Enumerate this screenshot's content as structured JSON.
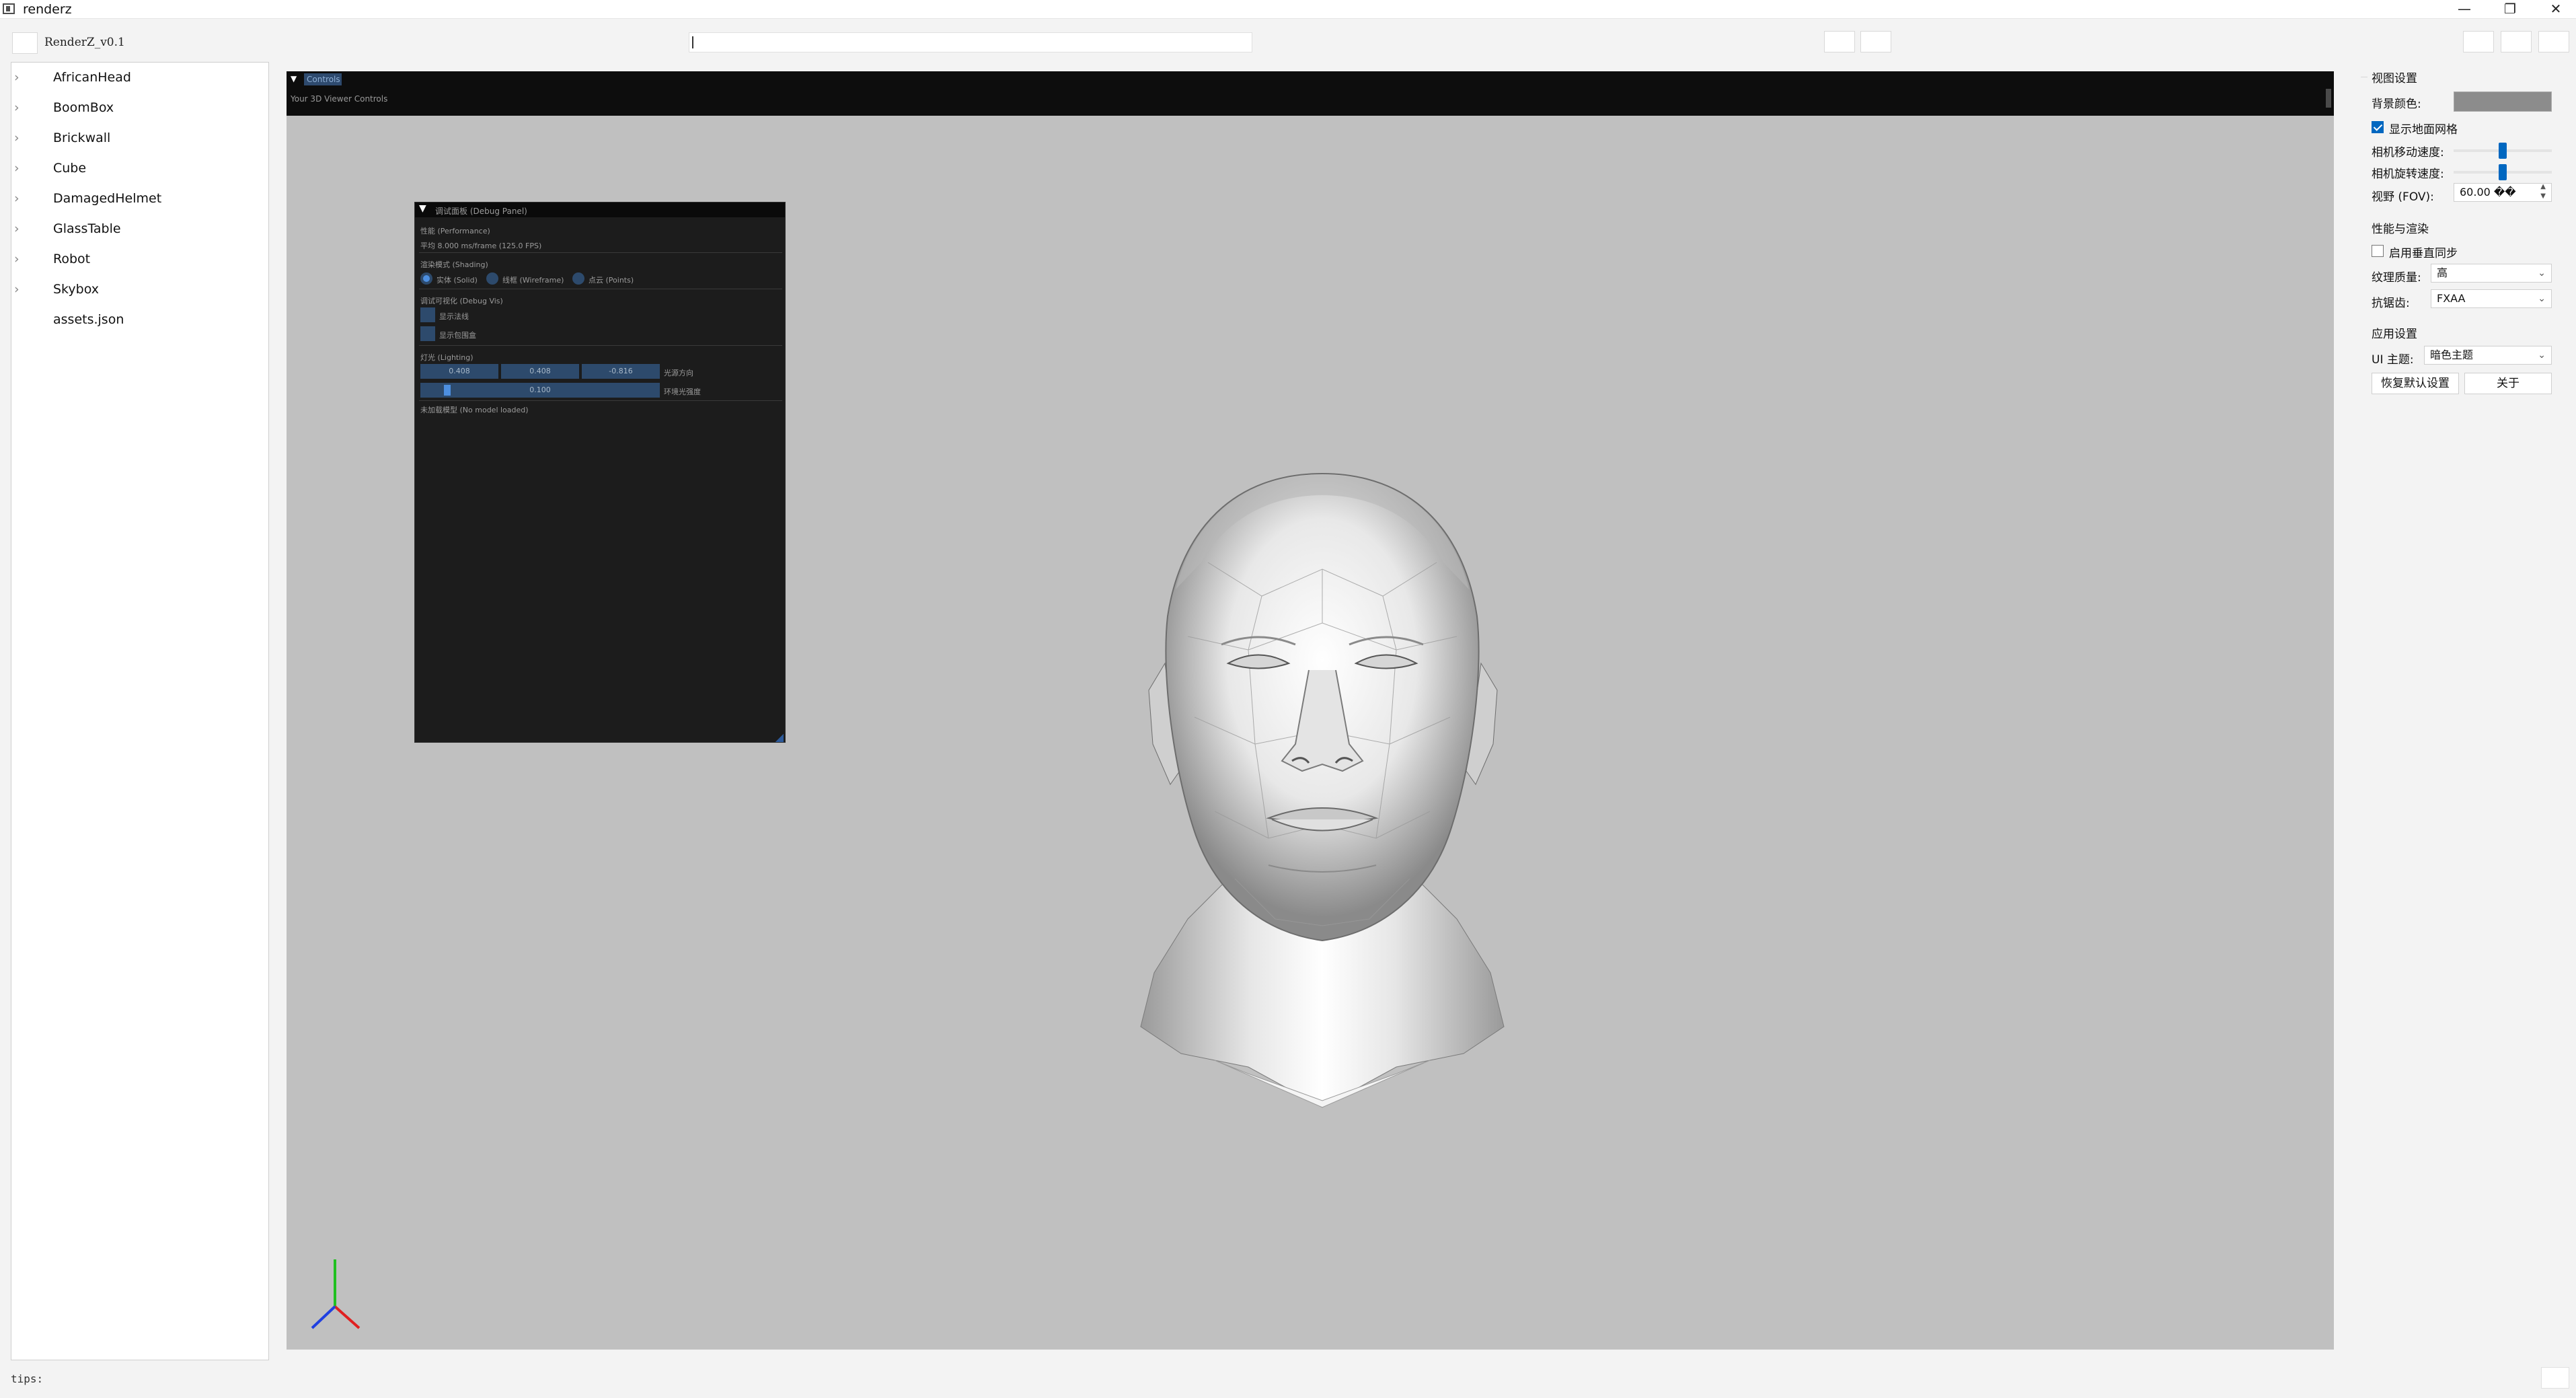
{
  "window": {
    "title": "renderz",
    "icon": "app-window-icon",
    "controls": [
      "minimize-icon",
      "restore-icon",
      "close-icon"
    ],
    "minimize_glyph": "—",
    "restore_glyph": "❐",
    "close_glyph": "✕"
  },
  "toolbar": {
    "version": "RenderZ_v0.1"
  },
  "tree": {
    "items": [
      {
        "label": "AfricanHead",
        "expandable": true
      },
      {
        "label": "BoomBox",
        "expandable": true
      },
      {
        "label": "Brickwall",
        "expandable": true
      },
      {
        "label": "Cube",
        "expandable": true
      },
      {
        "label": "DamagedHelmet",
        "expandable": true
      },
      {
        "label": "GlassTable",
        "expandable": true
      },
      {
        "label": "Robot",
        "expandable": true
      },
      {
        "label": "Skybox",
        "expandable": true
      },
      {
        "label": "assets.json",
        "expandable": false
      }
    ],
    "chevron": "›"
  },
  "viewport": {
    "background": "#c0c0c0",
    "controls_tab": "Controls",
    "controls_text": "Your 3D Viewer Controls",
    "debug": {
      "title": "调试面板 (Debug Panel)",
      "perf_header": "性能 (Performance)",
      "perf_value": "平均 8.000 ms/frame (125.0 FPS)",
      "shading_header": "渲染模式 (Shading)",
      "shading_options": [
        "实体 (Solid)",
        "线框 (Wireframe)",
        "点云 (Points)"
      ],
      "shading_selected": "实体 (Solid)",
      "debugvis_header": "调试可视化 (Debug Vis)",
      "debugvis_options": [
        "显示法线",
        "显示包围盒"
      ],
      "lighting_header": "灯光 (Lighting)",
      "light_dir": [
        "0.408",
        "0.408",
        "-0.816"
      ],
      "light_dir_label": "光源方向",
      "ambient_value": "0.100",
      "ambient_label": "环境光强度",
      "ambient_fraction": 0.1,
      "model_status": "未加载模型 (No model loaded)"
    },
    "axis_colors": {
      "x": "#e02020",
      "y": "#20c020",
      "z": "#2040e0"
    }
  },
  "settings": {
    "view_group": "视图设置",
    "bg_color_label": "背景颜色:",
    "bg_color_value": "#8c8c8c",
    "show_grid_label": "显示地面网格",
    "show_grid_checked": true,
    "cam_move_label": "相机移动速度:",
    "cam_move_fraction": 0.5,
    "cam_rotate_label": "相机旋转速度:",
    "cam_rotate_fraction": 0.5,
    "fov_label": "视野 (FOV):",
    "fov_value": "60.00 ��",
    "perf_group": "性能与渲染",
    "vsync_label": "启用垂直同步",
    "vsync_checked": false,
    "texture_label": "纹理质量:",
    "texture_value": "高",
    "aa_label": "抗锯齿:",
    "aa_value": "FXAA",
    "app_group": "应用设置",
    "theme_label": "UI 主题:",
    "theme_value": "暗色主题",
    "reset_button": "恢复默认设置",
    "about_button": "关于",
    "accent": "#0067c0"
  },
  "status": {
    "tips": "tips:"
  }
}
